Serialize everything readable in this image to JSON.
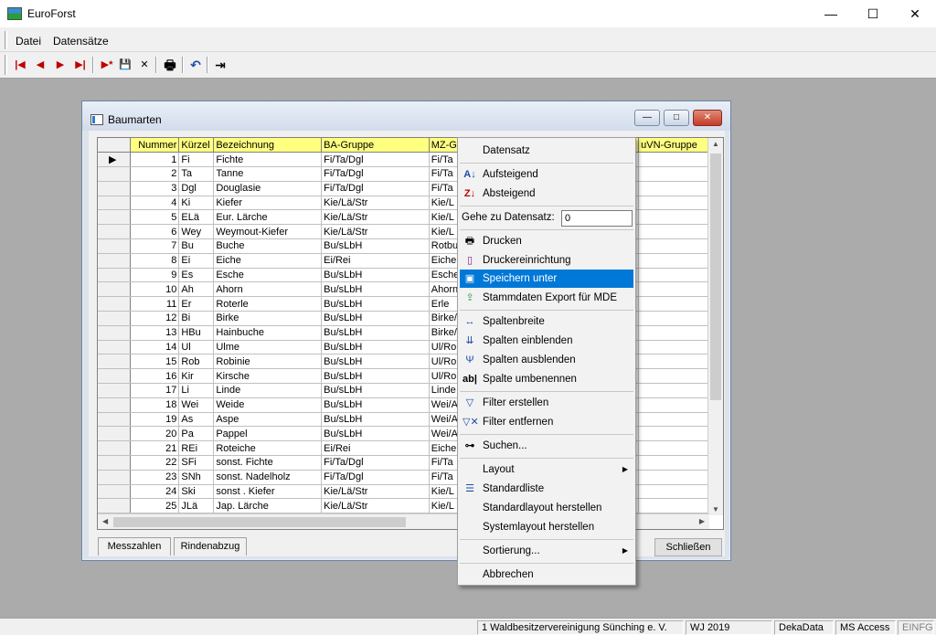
{
  "app": {
    "title": "EuroForst",
    "minimize": "—",
    "maximize": "☐",
    "close": "✕"
  },
  "menubar": {
    "items": [
      "Datei",
      "Datensätze"
    ]
  },
  "toolbar": {
    "first": "|◀",
    "prev": "◀",
    "next": "▶",
    "last": "▶|",
    "new": "▶*",
    "save": "💾",
    "delete": "✕",
    "print": "🖶",
    "undo": "↶",
    "exit": "⇥"
  },
  "child": {
    "title": "Baumarten",
    "min": "—",
    "max": "□",
    "close": "✕",
    "tabs": [
      "Messzahlen",
      "Rindenabzug"
    ],
    "close_button": "Schließen"
  },
  "grid": {
    "columns": [
      "Nummer",
      "Kürzel",
      "Bezeichnung",
      "BA-Gruppe",
      "MZ-G",
      "",
      "uVN-Gruppe"
    ],
    "current_row_marker": "▶",
    "rows": [
      [
        "1",
        "Fi",
        "Fichte",
        "Fi/Ta/Dgl",
        "Fi/Ta"
      ],
      [
        "2",
        "Ta",
        "Tanne",
        "Fi/Ta/Dgl",
        "Fi/Ta"
      ],
      [
        "3",
        "Dgl",
        "Douglasie",
        "Fi/Ta/Dgl",
        "Fi/Ta"
      ],
      [
        "4",
        "Ki",
        "Kiefer",
        "Kie/Lä/Str",
        "Kie/L"
      ],
      [
        "5",
        "ELä",
        "Eur. Lärche",
        "Kie/Lä/Str",
        "Kie/L"
      ],
      [
        "6",
        "Wey",
        "Weymout-Kiefer",
        "Kie/Lä/Str",
        "Kie/L"
      ],
      [
        "7",
        "Bu",
        "Buche",
        "Bu/sLbH",
        "Rotbu"
      ],
      [
        "8",
        "Ei",
        "Eiche",
        "Ei/Rei",
        "Eiche"
      ],
      [
        "9",
        "Es",
        "Esche",
        "Bu/sLbH",
        "Esche"
      ],
      [
        "10",
        "Ah",
        "Ahorn",
        "Bu/sLbH",
        "Ahorn"
      ],
      [
        "11",
        "Er",
        "Roterle",
        "Bu/sLbH",
        "Erle"
      ],
      [
        "12",
        "Bi",
        "Birke",
        "Bu/sLbH",
        "Birke/"
      ],
      [
        "13",
        "HBu",
        "Hainbuche",
        "Bu/sLbH",
        "Birke/"
      ],
      [
        "14",
        "Ul",
        "Ulme",
        "Bu/sLbH",
        "Ul/Ro"
      ],
      [
        "15",
        "Rob",
        "Robinie",
        "Bu/sLbH",
        "Ul/Ro"
      ],
      [
        "16",
        "Kir",
        "Kirsche",
        "Bu/sLbH",
        "Ul/Ro"
      ],
      [
        "17",
        "Li",
        "Linde",
        "Bu/sLbH",
        "Linde"
      ],
      [
        "18",
        "Wei",
        "Weide",
        "Bu/sLbH",
        "Wei/A"
      ],
      [
        "19",
        "As",
        "Aspe",
        "Bu/sLbH",
        "Wei/A"
      ],
      [
        "20",
        "Pa",
        "Pappel",
        "Bu/sLbH",
        "Wei/A"
      ],
      [
        "21",
        "REi",
        "Roteiche",
        "Ei/Rei",
        "Eiche"
      ],
      [
        "22",
        "SFi",
        "sonst. Fichte",
        "Fi/Ta/Dgl",
        "Fi/Ta"
      ],
      [
        "23",
        "SNh",
        "sonst. Nadelholz",
        "Fi/Ta/Dgl",
        "Fi/Ta"
      ],
      [
        "24",
        "Ski",
        "sonst . Kiefer",
        "Kie/Lä/Str",
        "Kie/L"
      ],
      [
        "25",
        "JLä",
        "Jap. Lärche",
        "Kie/Lä/Str",
        "Kie/L"
      ]
    ]
  },
  "context_menu": {
    "datensatz": "Datensatz",
    "aufsteigend": "Aufsteigend",
    "absteigend": "Absteigend",
    "goto_label": "Gehe zu Datensatz:",
    "goto_value": "0",
    "drucken": "Drucken",
    "druckereinrichtung": "Druckereinrichtung",
    "speichern_unter": "Speichern unter",
    "stammdaten_export": "Stammdaten Export für MDE",
    "spaltenbreite": "Spaltenbreite",
    "spalten_einblenden": "Spalten einblenden",
    "spalten_ausblenden": "Spalten ausblenden",
    "spalte_umbenennen": "Spalte umbenennen",
    "filter_erstellen": "Filter erstellen",
    "filter_entfernen": "Filter entfernen",
    "suchen": "Suchen...",
    "layout": "Layout",
    "standardliste": "Standardliste",
    "standardlayout": "Standardlayout herstellen",
    "systemlayout": "Systemlayout herstellen",
    "sortierung": "Sortierung...",
    "abbrechen": "Abbrechen",
    "highlight_color": "#0078d7"
  },
  "statusbar": {
    "org": "1 Waldbesitzervereinigung Sünching e. V.",
    "year": "WJ 2019",
    "vendor": "DekaData",
    "db": "MS Access",
    "mode": "EINFG"
  }
}
